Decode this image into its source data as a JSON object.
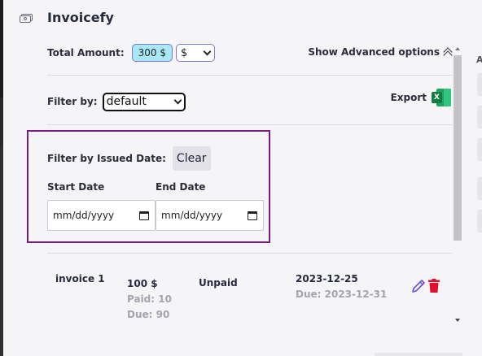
{
  "app": {
    "title": "Invoicefy",
    "icon": "money-bills-icon"
  },
  "total": {
    "label": "Total Amount:",
    "amount": "300 $",
    "currency": "$"
  },
  "advanced": {
    "label": "Show Advanced options",
    "icon": "double-chevron-up-icon"
  },
  "filter": {
    "label": "Filter by:",
    "selected": "default"
  },
  "export": {
    "label": "Export",
    "icon": "excel-icon"
  },
  "date_filter": {
    "title": "Filter by Issued Date:",
    "clear_label": "Clear",
    "start_label": "Start Date",
    "end_label": "End Date",
    "start_placeholder": "mm/dd/yyyy",
    "end_placeholder": "mm/dd/yyyy",
    "border_color": "#7b1a86"
  },
  "invoices": [
    {
      "name": "invoice 1",
      "amount": "100 $",
      "paid": "Paid: 10",
      "due": "Due: 90",
      "status": "Unpaid",
      "issued": "2023-12-25",
      "due_date": "Due: 2023-12-31"
    }
  ],
  "right_panel": {
    "letter": "A"
  },
  "colors": {
    "accent": "#7a79d6",
    "badge_bg": "#a9e9f6",
    "delete": "#e0102f",
    "edit": "#6a4fd8"
  }
}
